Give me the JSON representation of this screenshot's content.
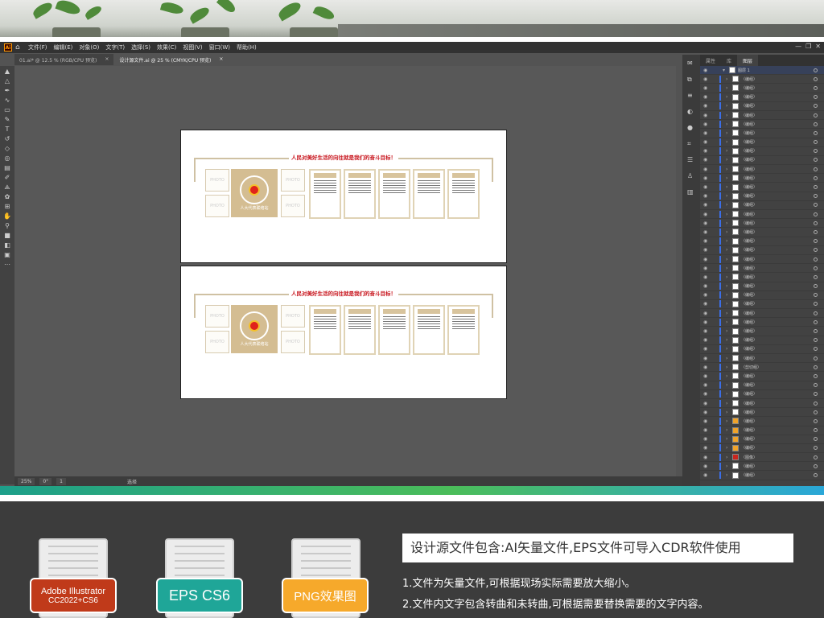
{
  "colors": {
    "accent": "#ff9a00",
    "layer_bar": "#3b6ee6",
    "banner_red": "#c8161e",
    "badge_ai": "#c03a1a",
    "badge_eps": "#1fa698",
    "badge_png": "#f6a92b"
  },
  "menubar": {
    "logo": "Ai",
    "items": [
      "文件(F)",
      "编辑(E)",
      "对象(O)",
      "文字(T)",
      "选择(S)",
      "效果(C)",
      "视图(V)",
      "窗口(W)",
      "帮助(H)"
    ],
    "win_controls": [
      "—",
      "❐",
      "✕"
    ]
  },
  "tabs": [
    {
      "label": "01.ai* @ 12.5 % (RGB/CPU 预览)",
      "close": "×"
    },
    {
      "label": "设计源文件.ai @ 25 % (CMYK/CPU 预览)",
      "close": "×"
    }
  ],
  "artboard": {
    "title": "人民对美好生活的向往就是我们的奋斗目标！",
    "photo_label": "PHOTO",
    "emblem_text": "人大代表联络站"
  },
  "statusbar": {
    "zoom": "25%",
    "angle": "0°",
    "page": "1",
    "mode": "选择"
  },
  "layers": {
    "tabs": [
      "属性",
      "库",
      "图层"
    ],
    "top_row": "图层 1",
    "rows": [
      {
        "name": "〈编组〉",
        "thumb": "w"
      },
      {
        "name": "〈编组〉",
        "thumb": "w"
      },
      {
        "name": "〈编组〉",
        "thumb": "w"
      },
      {
        "name": "〈编组〉",
        "thumb": "w"
      },
      {
        "name": "〈编组〉",
        "thumb": "w"
      },
      {
        "name": "〈编组〉",
        "thumb": "w"
      },
      {
        "name": "〈编组〉",
        "thumb": "w"
      },
      {
        "name": "〈编组〉",
        "thumb": "w"
      },
      {
        "name": "〈编组〉",
        "thumb": "w"
      },
      {
        "name": "〈编组〉",
        "thumb": "w"
      },
      {
        "name": "〈编组〉",
        "thumb": "w"
      },
      {
        "name": "〈编组〉",
        "thumb": "w"
      },
      {
        "name": "〈编组〉",
        "thumb": "w"
      },
      {
        "name": "〈编组〉",
        "thumb": "w"
      },
      {
        "name": "〈编组〉",
        "thumb": "w"
      },
      {
        "name": "〈编组〉",
        "thumb": "w"
      },
      {
        "name": "〈编组〉",
        "thumb": "w"
      },
      {
        "name": "〈编组〉",
        "thumb": "w"
      },
      {
        "name": "〈编组〉",
        "thumb": "w"
      },
      {
        "name": "〈编组〉",
        "thumb": "w"
      },
      {
        "name": "〈编组〉",
        "thumb": "w"
      },
      {
        "name": "〈编组〉",
        "thumb": "w"
      },
      {
        "name": "〈编组〉",
        "thumb": "w"
      },
      {
        "name": "〈编组〉",
        "thumb": "w"
      },
      {
        "name": "〈编组〉",
        "thumb": "w"
      },
      {
        "name": "〈编组〉",
        "thumb": "w"
      },
      {
        "name": "〈编组〉",
        "thumb": "w"
      },
      {
        "name": "〈编组〉",
        "thumb": "w"
      },
      {
        "name": "〈编组〉",
        "thumb": "w"
      },
      {
        "name": "〈编组〉",
        "thumb": "w"
      },
      {
        "name": "〈编组〉",
        "thumb": "w"
      },
      {
        "name": "〈编组〉",
        "thumb": "w"
      },
      {
        "name": "〈剪切组〉",
        "thumb": "w"
      },
      {
        "name": "〈编组〉",
        "thumb": "w"
      },
      {
        "name": "〈编组〉",
        "thumb": "w"
      },
      {
        "name": "〈编组〉",
        "thumb": "w"
      },
      {
        "name": "〈编组〉",
        "thumb": "w"
      },
      {
        "name": "〈编组〉",
        "thumb": "w"
      },
      {
        "name": "〈编组〉",
        "thumb": "o"
      },
      {
        "name": "〈编组〉",
        "thumb": "o"
      },
      {
        "name": "〈编组〉",
        "thumb": "o"
      },
      {
        "name": "〈编组〉",
        "thumb": "o"
      },
      {
        "name": "〈图像〉",
        "thumb": "r"
      },
      {
        "name": "〈编组〉",
        "thumb": "w"
      },
      {
        "name": "〈编组〉",
        "thumb": "w"
      }
    ]
  },
  "bottom": {
    "badges": [
      {
        "line1": "Adobe Illustrator",
        "line2": "CC2022+CS6"
      },
      {
        "line1": "EPS CS6",
        "line2": ""
      },
      {
        "line1": "PNG效果图",
        "line2": ""
      }
    ],
    "info_title": "设计源文件包含:AI矢量文件,EPS文件可导入CDR软件使用",
    "info_lines": [
      "1.文件为矢量文件,可根据现场实际需要放大缩小。",
      "2.文件内文字包含转曲和未转曲,可根据需要替换需要的文字内容。"
    ]
  }
}
